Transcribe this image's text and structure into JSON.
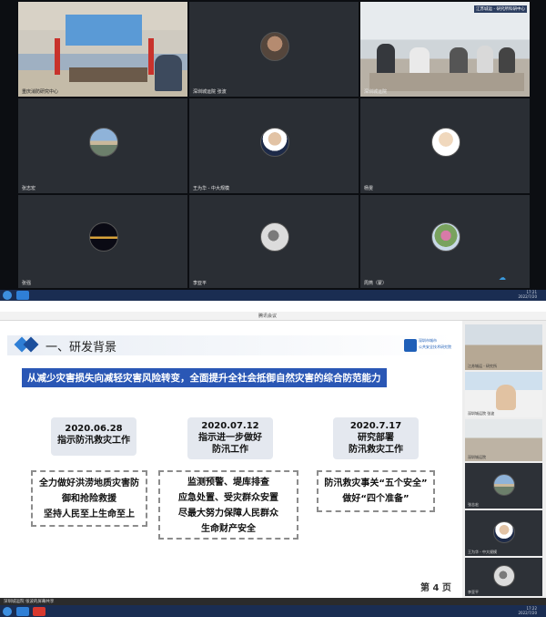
{
  "top_grid": {
    "tiles": [
      {
        "name": "重庆消防研究中心",
        "kind": "photo"
      },
      {
        "name": "深圳城运院 张波",
        "kind": "avatar"
      },
      {
        "name": "深圳城运院",
        "kind": "photo"
      },
      {
        "name": "张志宏",
        "kind": "avatar"
      },
      {
        "name": "王为华 - 中大规模",
        "kind": "avatar"
      },
      {
        "name": "杨雯",
        "kind": "avatar"
      },
      {
        "name": "张强",
        "kind": "avatar"
      },
      {
        "name": "李亚平",
        "kind": "avatar"
      },
      {
        "name": "周燕（蒙）",
        "kind": "avatar"
      }
    ],
    "corner_label": "江苏城运 - 研究所科研中心",
    "taskbar_time": "17:21",
    "taskbar_date": "2022/7/20"
  },
  "bottom": {
    "window_title": "腾讯会议",
    "slide": {
      "section_title": "一、研发背景",
      "banner": "从减少灾害损失向减轻灾害风险转变，全面提升全社会抵御自然灾害的综合防范能力",
      "logo_text": [
        "深圳市城市",
        "公共安全技术研究院"
      ],
      "columns": [
        {
          "date": "2020.06.28",
          "subtitle_lines": [
            "指示防汛救灾工作"
          ],
          "body_lines": [
            "全力做好洪涝地质灾害防",
            "御和抢险救援",
            "坚持人民至上生命至上"
          ]
        },
        {
          "date": "2020.07.12",
          "subtitle_lines": [
            "指示进一步做好",
            "防汛工作"
          ],
          "body_lines": [
            "监测预警、堤库排查",
            "应急处置、受灾群众安置",
            "尽最大努力保障人民群众",
            "生命财产安全"
          ]
        },
        {
          "date": "2020.7.17",
          "subtitle_lines": [
            "研究部署",
            "防汛救灾工作"
          ],
          "body_lines": [
            "防汛救灾事关“五个安全”",
            "做好“四个准备”"
          ]
        }
      ],
      "page_number": "第 4 页"
    },
    "sidebar_tiles": [
      {
        "name": "江苏城运 - 研究所",
        "kind": "photo"
      },
      {
        "name": "深圳城运院 张波",
        "kind": "photo"
      },
      {
        "name": "深圳城运院",
        "kind": "photo"
      },
      {
        "name": "张志宏",
        "kind": "avatar"
      },
      {
        "name": "王为华 - 中大规模",
        "kind": "avatar"
      },
      {
        "name": "李亚平",
        "kind": "avatar"
      }
    ],
    "bottom_left_label": "深圳城运院 张波的屏幕共享",
    "taskbar_time": "17:22",
    "taskbar_date": "2022/7/20"
  },
  "colors": {
    "banner_blue": "#2a57b5",
    "diamond_blue": "#2f7fd6",
    "taskbar": "#1a2d52",
    "tile_dark": "#2a2e34"
  }
}
